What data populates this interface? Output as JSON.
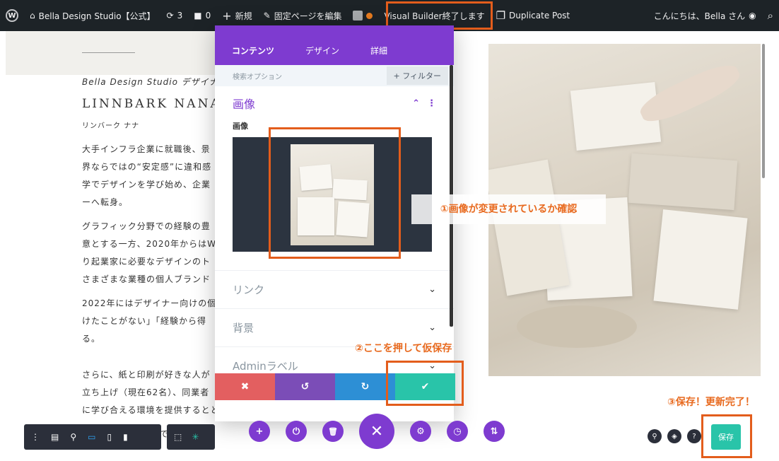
{
  "admin_bar": {
    "site_name": "Bella Design Studio【公式】",
    "updates_count": "3",
    "comments_count": "0",
    "new_label": "新規",
    "edit_label": "固定ページを編集",
    "visual_builder_label": "Visual Builder終了します",
    "duplicate_label": "Duplicate Post",
    "greeting": "こんにちは、Bella さん"
  },
  "article": {
    "subtitle": "Bella Design Studio デザイナ",
    "name": "LINNBARK NANA",
    "kana": "リンバーク ナナ",
    "paragraphs": [
      [
        "大手インフラ企業に就職後、景",
        "界ならではの“安定感”に違和感",
        "学でデザインを学び始め、企業",
        "ーへ転身。"
      ],
      [
        "グラフィック分野での経験の豊",
        "意とする一方、2020年からはW",
        "り起業家に必要なデザインのト",
        "さまざまな業種の個人ブランド"
      ],
      [
        "2022年にはデザイナー向けの個",
        "けたことがない」「経験から得",
        "る。"
      ]
    ],
    "bottom_lines": [
      "さらに、紙と印刷が好きな人が",
      "立ち上げ（現在62名）、同業者",
      "に学び合える環境を提供するとともに、デザイナーのデザインレベルの"
    ],
    "last_fragment": "で"
  },
  "panel": {
    "tabs": [
      "コンテンツ",
      "デザイン",
      "詳細"
    ],
    "search_placeholder": "検索オプション",
    "filter_label": "+ フィルター",
    "image_section_title": "画像",
    "image_field_label": "画像",
    "toggles": [
      "リンク",
      "背景",
      "Adminラベル"
    ]
  },
  "annotations": {
    "step1": "①画像が変更されているか確認",
    "step2": "②ここを押して仮保存",
    "step3": "③保存！更新完了！"
  },
  "bottom_bar": {
    "save_label": "保存"
  },
  "icons": {
    "wp_logo": "W",
    "site": "⌂",
    "updates": "⟳",
    "comments": "■",
    "new": "+",
    "edit": "✎",
    "duplicate": "❐",
    "search": "⌕",
    "user": "◉",
    "chevron_up": "⌃",
    "more": "⋮",
    "chevron_down": "⌄",
    "close": "✖",
    "undo": "↺",
    "redo": "↻",
    "check": "✔",
    "big_close": "✕",
    "add": "+",
    "power": "⏻",
    "trash": "🗑",
    "settings": "⚙",
    "history": "◷",
    "portability": "⇅",
    "menu": "⋮",
    "layers": "▤",
    "zoom": "⚲",
    "desktop": "▭",
    "tablet": "▯",
    "phone": "▮",
    "wireframe": "⬚",
    "click_mode": "✳",
    "zoom_small": "⚲",
    "layers_small": "◈",
    "help": "?"
  },
  "colors": {
    "admin_bg": "#1d2327",
    "purple": "#7e3bd0",
    "red": "#e35f60",
    "purple_dark": "#7b4db7",
    "blue": "#2d8fd5",
    "green": "#29c4a9",
    "highlight": "#e35d1c",
    "annotation_text": "#e86a1f"
  }
}
